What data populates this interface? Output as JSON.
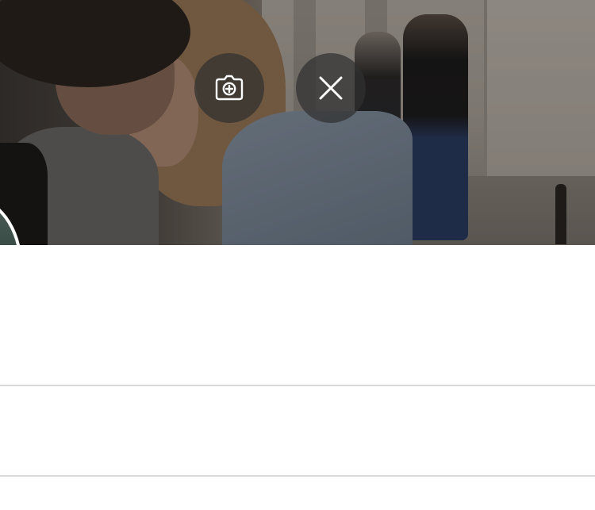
{
  "header": {
    "photo_semantic": "header-photo",
    "actions": {
      "add_photo_icon": "camera-plus-icon",
      "remove_photo_icon": "close-icon"
    },
    "overlay_button_color": "#303030"
  },
  "profile": {
    "avatar_semantic": "avatar"
  },
  "colors": {
    "background": "#ffffff",
    "divider": "#d8d8d8",
    "icon": "#ffffff"
  }
}
